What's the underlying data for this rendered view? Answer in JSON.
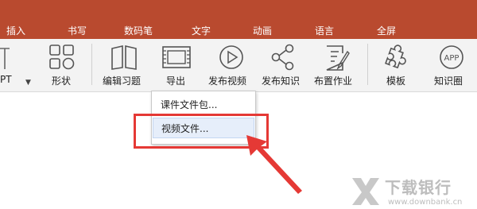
{
  "menu": {
    "items": [
      "插入",
      "书写",
      "数码笔",
      "文字",
      "动画",
      "语言",
      "全屏"
    ]
  },
  "ribbon": {
    "partial_label": "PT",
    "tools": [
      {
        "label": "形状",
        "icon": "shapes-icon"
      },
      {
        "label": "编辑习题",
        "icon": "book-icon"
      },
      {
        "label": "导出",
        "icon": "export-film-icon"
      },
      {
        "label": "发布视频",
        "icon": "play-circle-icon"
      },
      {
        "label": "发布知识",
        "icon": "share-icon"
      },
      {
        "label": "布置作业",
        "icon": "edit-doc-icon"
      },
      {
        "label": "模板",
        "icon": "puzzle-icon"
      },
      {
        "label": "知识圈",
        "icon": "app-circle-icon"
      }
    ],
    "app_icon_text": "APP"
  },
  "dropdown": {
    "items": [
      "课件文件包...",
      "视频文件..."
    ]
  },
  "watermark": {
    "title": "下载银行",
    "url": "www.downbank.cn"
  },
  "colors": {
    "menubar": "#b94a2f",
    "highlight": "#e53935",
    "hover": "#e6eefa"
  }
}
